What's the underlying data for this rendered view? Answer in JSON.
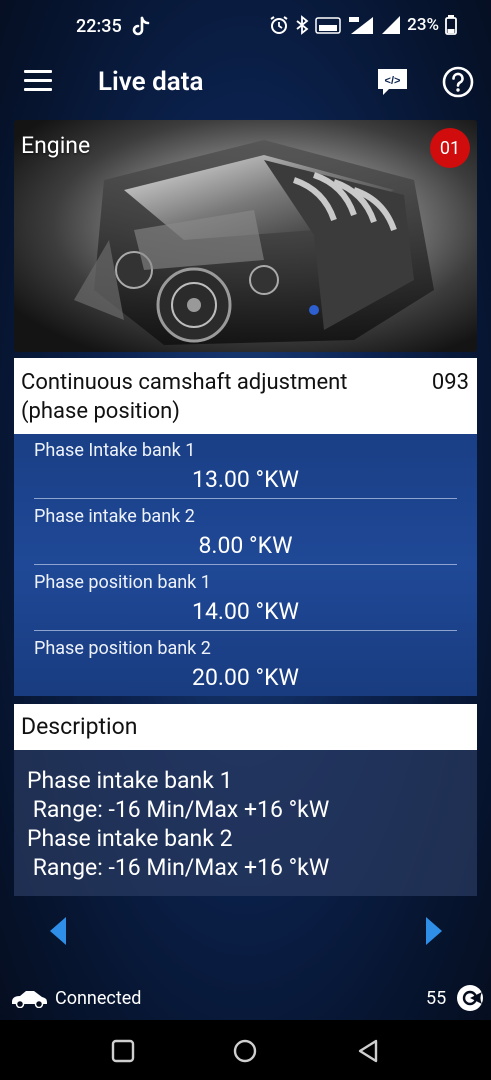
{
  "status_bar": {
    "time": "22:35",
    "battery": "23%"
  },
  "app_bar": {
    "title": "Live data",
    "menu_icon": "hamburger-menu-icon",
    "code_icon": "code-chat-icon",
    "help_icon": "help-circle-icon"
  },
  "engine_card": {
    "title": "Engine",
    "module_badge": "01",
    "badge_color": "#d00c0c"
  },
  "group": {
    "title": "Continuous camshaft adjustment (phase position)",
    "number": "093"
  },
  "values": [
    {
      "label": "Phase Intake bank 1",
      "value": "13.00 °KW"
    },
    {
      "label": "Phase intake bank 2",
      "value": "8.00 °KW"
    },
    {
      "label": "Phase position bank 1",
      "value": "14.00 °KW"
    },
    {
      "label": "Phase position bank 2",
      "value": "20.00 °KW"
    }
  ],
  "description": {
    "title": "Description",
    "lines": [
      "Phase intake bank 1",
      " Range: -16 Min/Max +16 °kW",
      "Phase intake bank 2",
      " Range: -16 Min/Max +16 °kW"
    ]
  },
  "navigation": {
    "prev_icon": "triangle-left-icon",
    "next_icon": "triangle-right-icon",
    "accent": "#2f8fe8"
  },
  "footer": {
    "connection_status": "Connected",
    "count": "55"
  },
  "colors": {
    "panel_blue": "#1f4896",
    "header_white": "#ffffff"
  }
}
